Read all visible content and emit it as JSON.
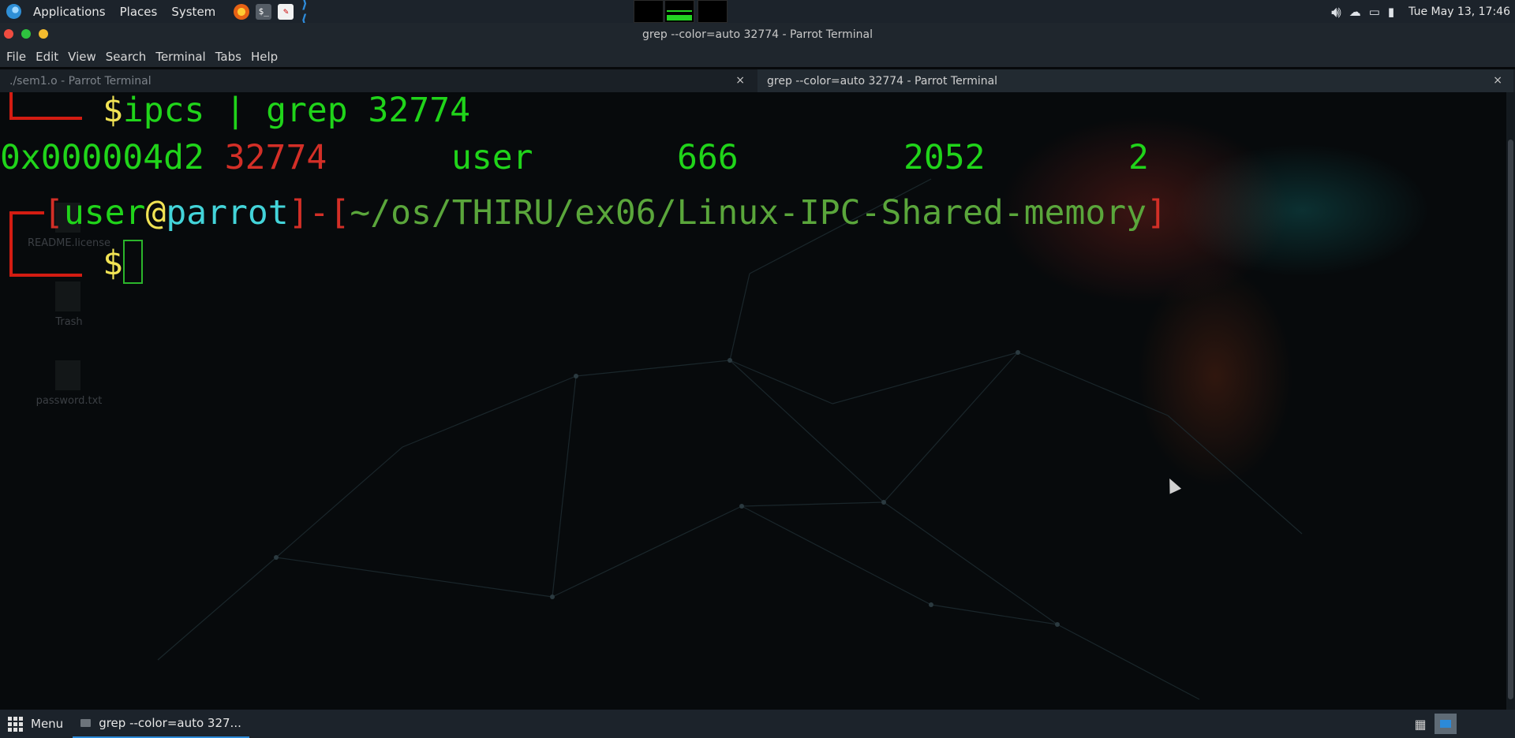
{
  "top_panel": {
    "menus": [
      "Applications",
      "Places",
      "System"
    ],
    "launchers": {
      "terminal_glyph": "$_",
      "vscode_glyph": "⟩⟨"
    },
    "clock": "Tue May 13, 17:46"
  },
  "window": {
    "title": "grep --color=auto 32774 - Parrot Terminal"
  },
  "menubar": [
    "File",
    "Edit",
    "View",
    "Search",
    "Terminal",
    "Tabs",
    "Help"
  ],
  "tabs": [
    {
      "label": "./sem1.o - Parrot Terminal",
      "active": false
    },
    {
      "label": "grep --color=auto 32774 - Parrot Terminal",
      "active": true
    }
  ],
  "tab_close_glyph": "×",
  "desktop_icons": [
    "README.license",
    "Trash",
    "password.txt"
  ],
  "terminal": {
    "command_prompt_symbol": "$",
    "command": "ipcs | grep 32774",
    "output": {
      "key": "0x000004d2",
      "shmid": "32774",
      "owner": "user",
      "perms": "666",
      "bytes": "2052",
      "nattch": "2"
    },
    "prompt": {
      "open": "[",
      "user": "user",
      "at": "@",
      "host": "parrot",
      "close": "]",
      "dash": "-",
      "path_open": "[",
      "path": "~/os/THIRU/ex06/Linux-IPC-Shared-memory",
      "path_close": "]",
      "symbol": "$"
    }
  },
  "bottom_panel": {
    "menu_label": "Menu",
    "task_label": "grep --color=auto 327..."
  },
  "colors": {
    "green": "#20d41a",
    "yellow": "#f1e354",
    "red": "#d32f27",
    "cyan": "#43d4d9",
    "accent": "#2c8ad8"
  }
}
